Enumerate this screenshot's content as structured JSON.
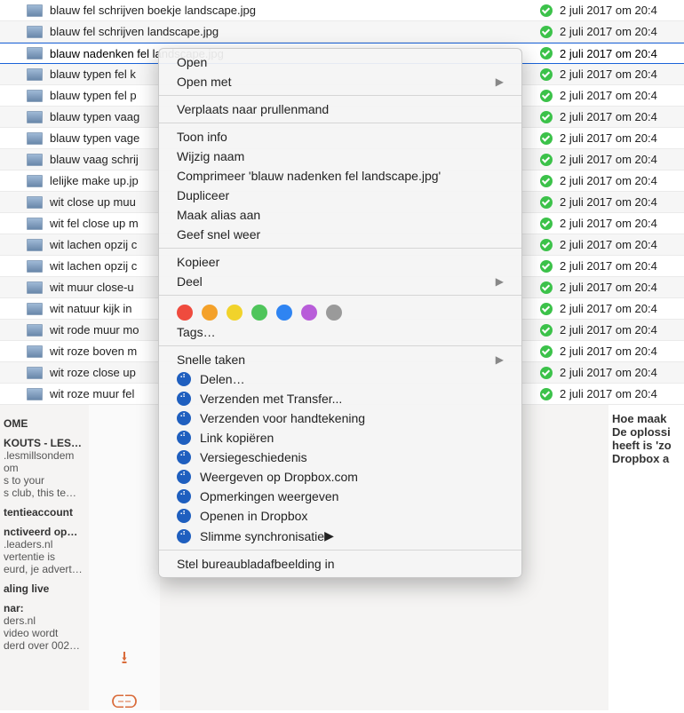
{
  "files": [
    {
      "name": "blauw fel schrijven boekje landscape.jpg",
      "date": "2 juli 2017 om 20:4"
    },
    {
      "name": "blauw fel schrijven landscape.jpg",
      "date": "2 juli 2017 om 20:4"
    },
    {
      "name": "blauw nadenken fel landscape.jpg",
      "date": "2 juli 2017 om 20:4",
      "selected": true
    },
    {
      "name": "blauw typen fel k",
      "date": "2 juli 2017 om 20:4"
    },
    {
      "name": "blauw typen fel p",
      "date": "2 juli 2017 om 20:4"
    },
    {
      "name": "blauw typen vaag",
      "date": "2 juli 2017 om 20:4"
    },
    {
      "name": "blauw typen vage",
      "date": "2 juli 2017 om 20:4"
    },
    {
      "name": "blauw vaag schrij",
      "date": "2 juli 2017 om 20:4"
    },
    {
      "name": "lelijke make up.jp",
      "date": "2 juli 2017 om 20:4"
    },
    {
      "name": "wit close up muu",
      "date": "2 juli 2017 om 20:4"
    },
    {
      "name": "wit fel close up m",
      "date": "2 juli 2017 om 20:4"
    },
    {
      "name": "wit lachen opzij c",
      "date": "2 juli 2017 om 20:4"
    },
    {
      "name": "wit lachen opzij c",
      "date": "2 juli 2017 om 20:4"
    },
    {
      "name": "wit muur close-u",
      "date": "2 juli 2017 om 20:4"
    },
    {
      "name": "wit natuur kijk in",
      "date": "2 juli 2017 om 20:4"
    },
    {
      "name": "wit rode muur mo",
      "date": "2 juli 2017 om 20:4"
    },
    {
      "name": "wit roze boven m",
      "date": "2 juli 2017 om 20:4"
    },
    {
      "name": "wit roze close up",
      "date": "2 juli 2017 om 20:4"
    },
    {
      "name": "wit roze muur fel",
      "date": "2 juli 2017 om 20:4"
    }
  ],
  "menu": {
    "open": "Open",
    "open_with": "Open met",
    "trash": "Verplaats naar prullenmand",
    "info": "Toon info",
    "rename": "Wijzig naam",
    "compress": "Comprimeer 'blauw nadenken fel landscape.jpg'",
    "duplicate": "Dupliceer",
    "alias": "Maak alias aan",
    "quicklook": "Geef snel weer",
    "copy": "Kopieer",
    "share": "Deel",
    "tags_label": "Tags…",
    "quick_actions": "Snelle taken",
    "dropbox": {
      "share": "Delen…",
      "transfer": "Verzenden met Transfer...",
      "signature": "Verzenden voor handtekening",
      "copylink": "Link kopiëren",
      "history": "Versiegeschiedenis",
      "viewweb": "Weergeven op Dropbox.com",
      "comments": "Opmerkingen weergeven",
      "openin": "Openen in Dropbox",
      "smartsync": "Slimme synchronisatie"
    },
    "wallpaper": "Stel bureaubladafbeelding in"
  },
  "tag_colors": [
    "#ef4b3e",
    "#f4a12a",
    "#f1d32b",
    "#4fc55b",
    "#2f84f2",
    "#b85dd9",
    "#9a9a9a"
  ],
  "sidebar_left": {
    "l0": "OME",
    "l1": "KOUTS - LES…",
    "l2": ".lesmillsondem",
    "l3": "om",
    "l4": "s to your",
    "l5": "s club, this te…",
    "t1": "tentieaccount",
    "t2": "nctiveerd op…",
    "l6": ".leaders.nl",
    "l7": "vertentie is",
    "l8": "eurd, je advert…",
    "t3": "aling live",
    "t4": "nar:",
    "l9": "ders.nl",
    "l10": "video wordt",
    "l11": "derd over 002…"
  },
  "right_panel": {
    "r0": "Hoe maak",
    "r1": "De oplossi",
    "r2": "heeft is 'zo",
    "r3": "Dropbox a"
  }
}
